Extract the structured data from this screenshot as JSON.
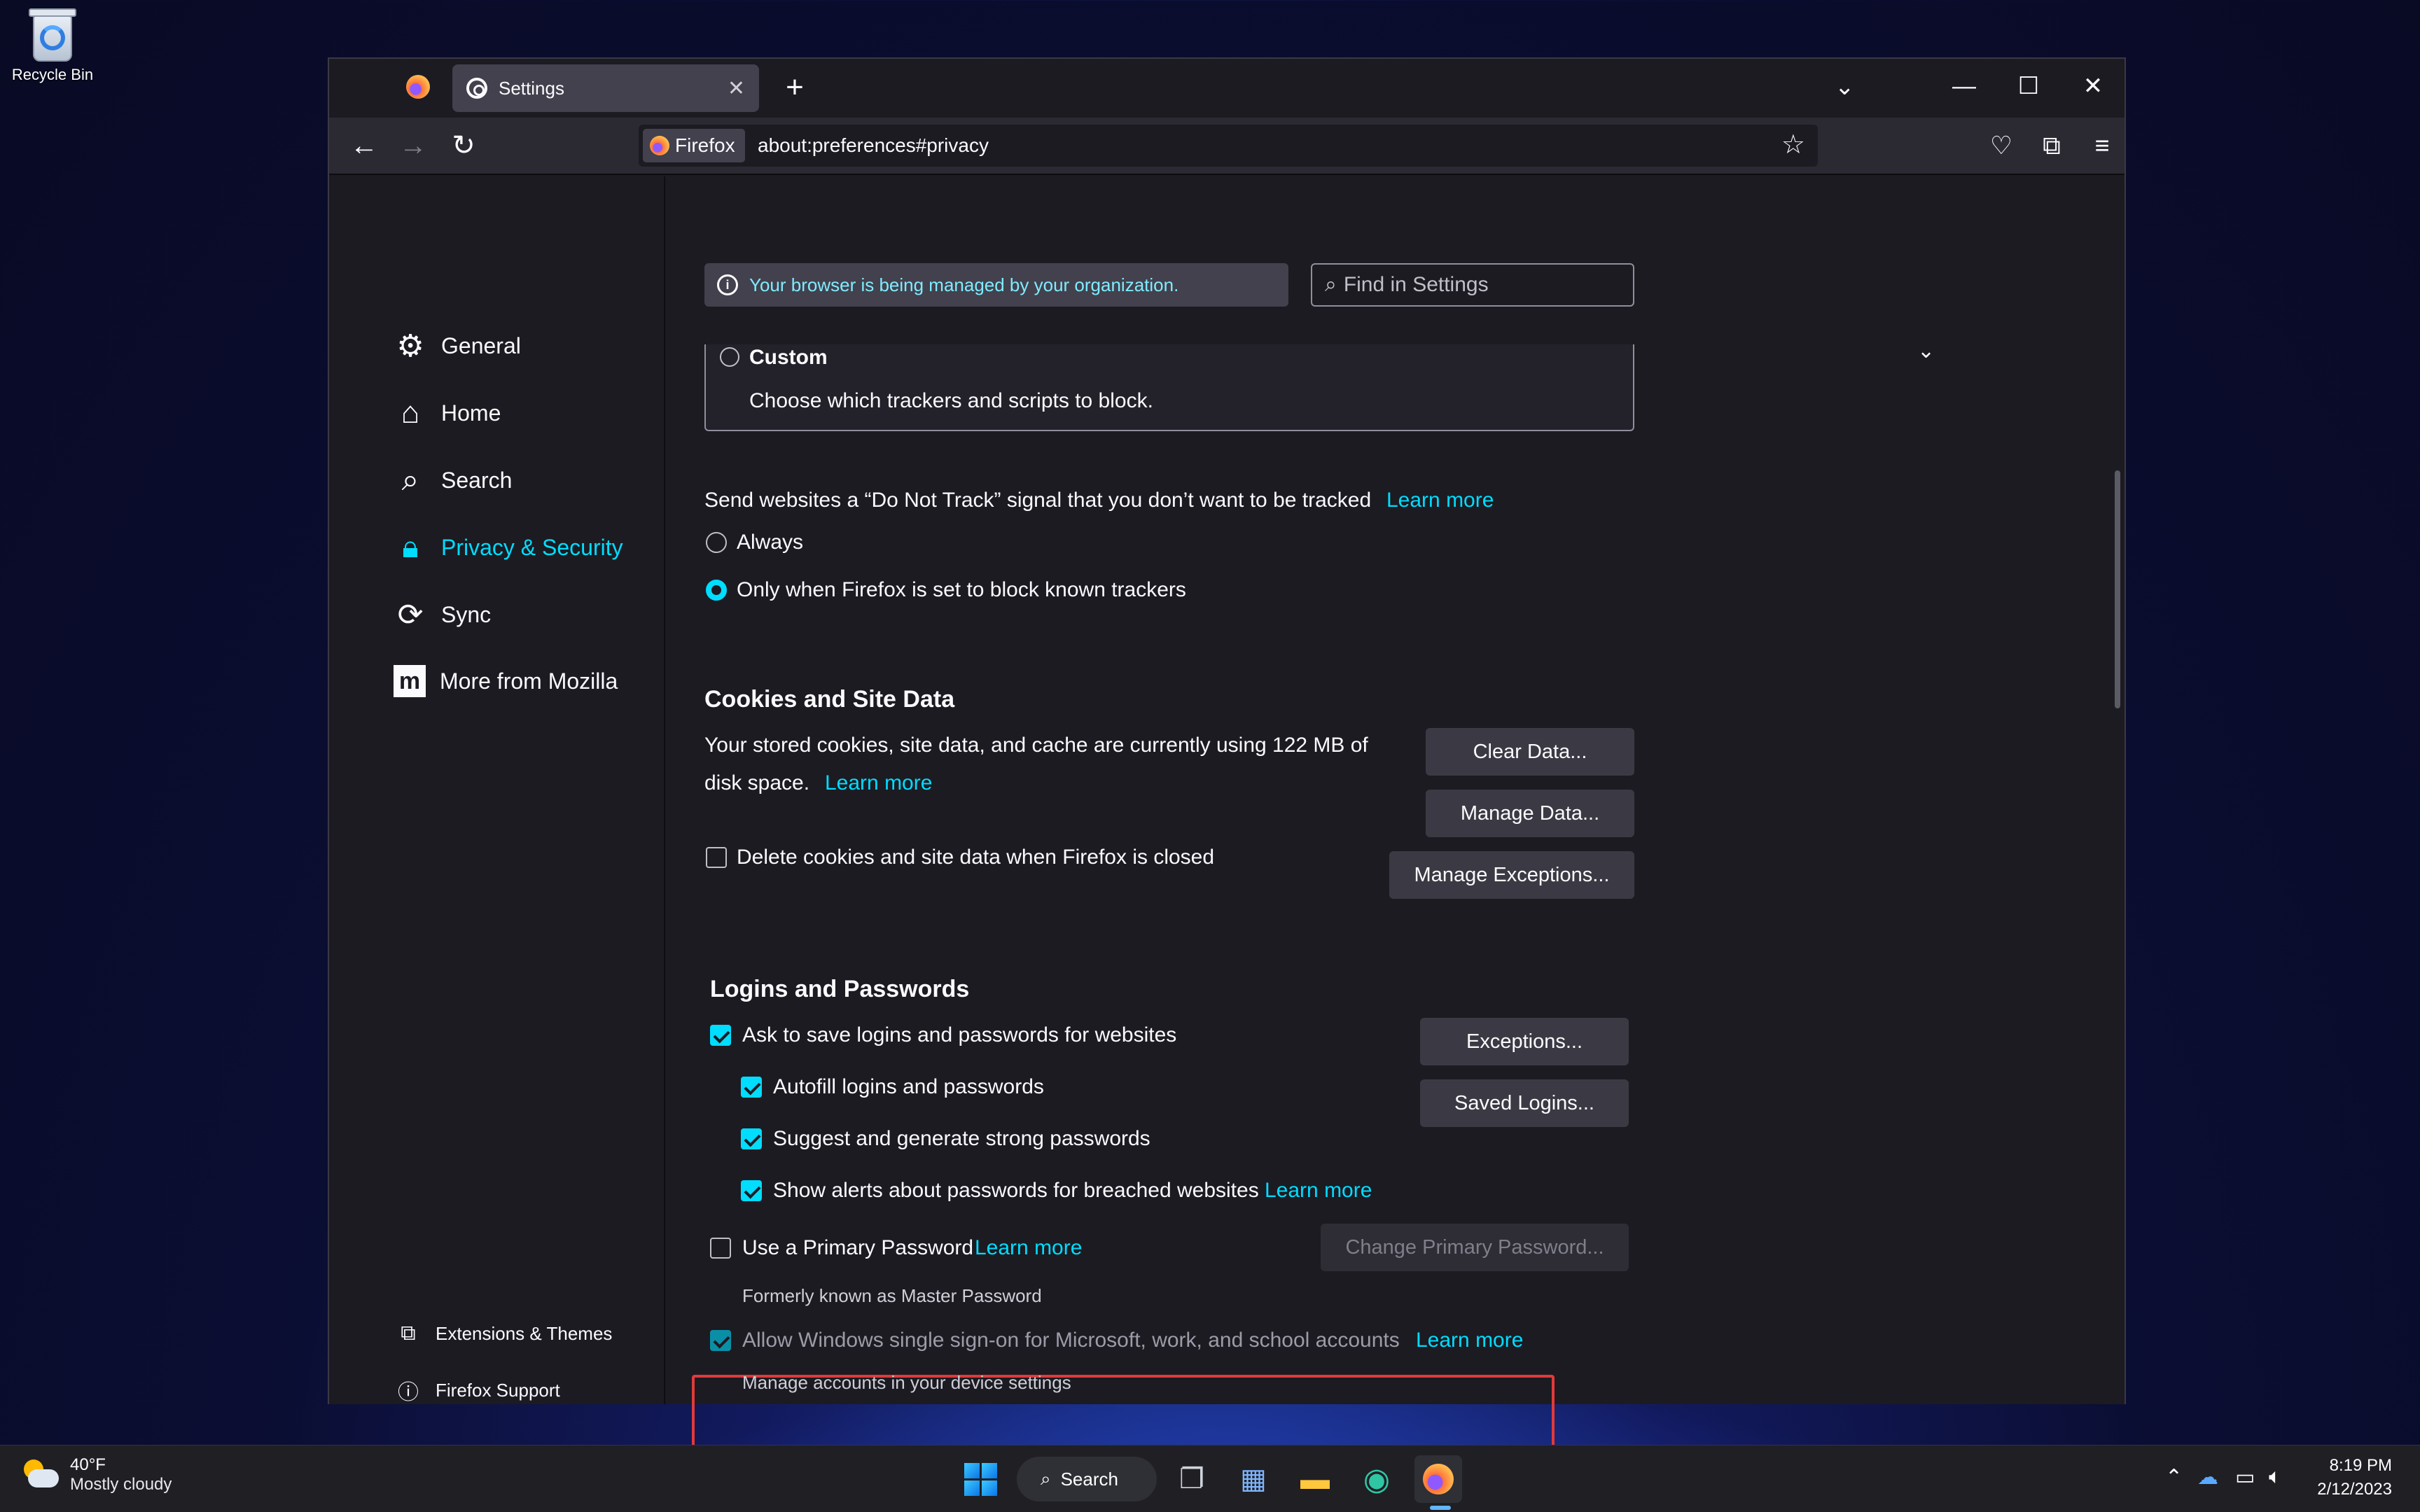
{
  "desktop": {
    "recycle_bin_label": "Recycle Bin"
  },
  "browser": {
    "tab_title": "Settings",
    "identity_label": "Firefox",
    "url": "about:preferences#privacy"
  },
  "sidebar": {
    "items": [
      {
        "label": "General",
        "icon": "gear-icon"
      },
      {
        "label": "Home",
        "icon": "home-icon"
      },
      {
        "label": "Search",
        "icon": "search-icon"
      },
      {
        "label": "Privacy & Security",
        "icon": "lock-icon",
        "active": true
      },
      {
        "label": "Sync",
        "icon": "sync-icon"
      },
      {
        "label": "More from Mozilla",
        "icon": "mozilla-icon"
      }
    ],
    "footer": [
      {
        "label": "Extensions & Themes",
        "icon": "puzzle-icon"
      },
      {
        "label": "Firefox Support",
        "icon": "help-icon"
      }
    ]
  },
  "banner": {
    "managed_text": "Your browser is being managed by your organization."
  },
  "find": {
    "placeholder": "Find in Settings"
  },
  "tracking": {
    "custom_label": "Custom",
    "custom_desc": "Choose which trackers and scripts to block."
  },
  "dnt": {
    "label": "Send websites a “Do Not Track” signal that you don’t want to be tracked",
    "learn_more": "Learn more",
    "always": "Always",
    "only_when": "Only when Firefox is set to block known trackers",
    "selected": "only_when"
  },
  "cookies": {
    "heading": "Cookies and Site Data",
    "desc_line1": "Your stored cookies, site data, and cache are currently using 122 MB of",
    "desc_line2": "disk space.",
    "learn_more": "Learn more",
    "clear_btn": "Clear Data...",
    "manage_btn": "Manage Data...",
    "exceptions_btn": "Manage Exceptions...",
    "delete_on_close": "Delete cookies and site data when Firefox is closed",
    "delete_on_close_checked": false
  },
  "logins": {
    "heading": "Logins and Passwords",
    "ask_to_save": "Ask to save logins and passwords for websites",
    "autofill": "Autofill logins and passwords",
    "suggest": "Suggest and generate strong passwords",
    "alerts": "Show alerts about passwords for breached websites",
    "alerts_learn_more": "Learn more",
    "exceptions_btn": "Exceptions...",
    "saved_logins_btn": "Saved Logins...",
    "primary_password": "Use a Primary Password",
    "primary_learn_more": "Learn more",
    "change_primary_btn": "Change Primary Password...",
    "formerly": "Formerly known as Master Password",
    "sso": "Allow Windows single sign-on for Microsoft, work, and school accounts",
    "sso_learn_more": "Learn more",
    "sso_manage": "Manage accounts in your device settings"
  },
  "taskbar": {
    "temperature": "40°F",
    "weather": "Mostly cloudy",
    "search_label": "Search",
    "time": "8:19 PM",
    "date": "2/12/2023"
  },
  "colors": {
    "accent": "#00ddff",
    "highlight": "#e03a3a"
  }
}
